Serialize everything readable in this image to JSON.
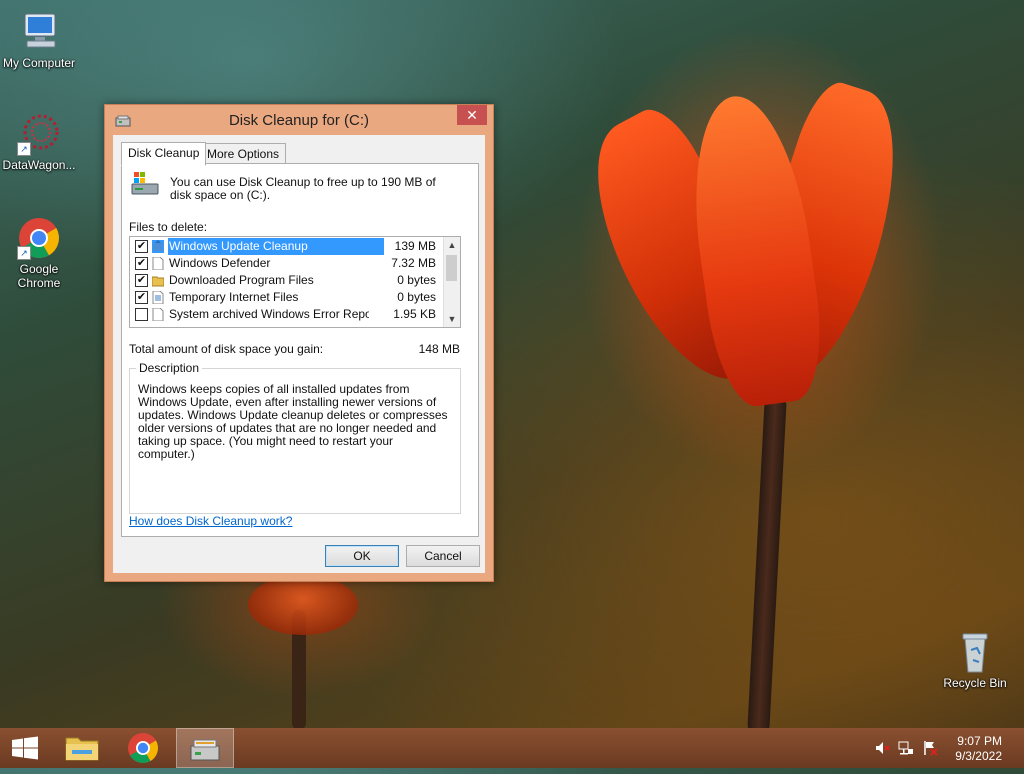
{
  "desktop": {
    "icons": [
      {
        "label": "My Computer"
      },
      {
        "label": "DataWagon..."
      },
      {
        "label": "Google Chrome"
      },
      {
        "label": "Recycle Bin"
      }
    ]
  },
  "window": {
    "title": "Disk Cleanup for  (C:)",
    "close_glyph": "✕",
    "tabs": [
      {
        "label": "Disk Cleanup"
      },
      {
        "label": "More Options"
      }
    ],
    "intro": "You can use Disk Cleanup to free up to 190 MB of disk space on  (C:).",
    "files_label": "Files to delete:",
    "files": [
      {
        "name": "Windows Update Cleanup",
        "size": "139 MB",
        "checked": true,
        "icon": "update-icon"
      },
      {
        "name": "Windows Defender",
        "size": "7.32 MB",
        "checked": true,
        "icon": "page-icon"
      },
      {
        "name": "Downloaded Program Files",
        "size": "0 bytes",
        "checked": true,
        "icon": "folder-icon"
      },
      {
        "name": "Temporary Internet Files",
        "size": "0 bytes",
        "checked": true,
        "icon": "internet-files-icon"
      },
      {
        "name": "System archived Windows Error Repor...",
        "size": "1.95 KB",
        "checked": false,
        "icon": "page-icon"
      }
    ],
    "check_glyph": "✔",
    "total_label": "Total amount of disk space you gain:",
    "total_value": "148 MB",
    "description_legend": "Description",
    "description_text": "Windows keeps copies of all installed updates from Windows Update, even after installing newer versions of updates. Windows Update cleanup deletes or compresses older versions of updates that are no longer needed and taking up space. (You might need to restart your computer.)",
    "help_link": "How does Disk Cleanup work?",
    "ok_label": "OK",
    "cancel_label": "Cancel"
  },
  "taskbar": {
    "clock_time": "9:07 PM",
    "clock_date": "9/3/2022"
  },
  "colors": {
    "selection": "#3399ff",
    "close_button": "#c75050",
    "window_frame": "#e9a87f",
    "link": "#0066cc"
  }
}
